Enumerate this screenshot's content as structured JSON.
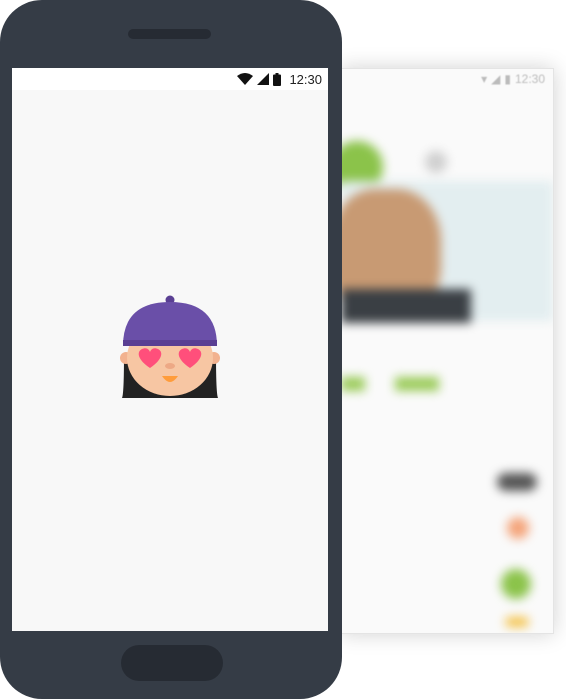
{
  "phone": {
    "status_time": "12:30",
    "icons": [
      "wifi-icon",
      "signal-icon",
      "battery-icon"
    ]
  },
  "background_screen": {
    "status_time": "12:30"
  },
  "colors": {
    "phone_body": "#353c46",
    "screen_bg": "#f8f8f8",
    "cap": "#6a4fa8",
    "heart": "#ff4f7b",
    "skin": "#f7c6a3",
    "hair": "#222222",
    "accent_green": "#8bc34a"
  }
}
